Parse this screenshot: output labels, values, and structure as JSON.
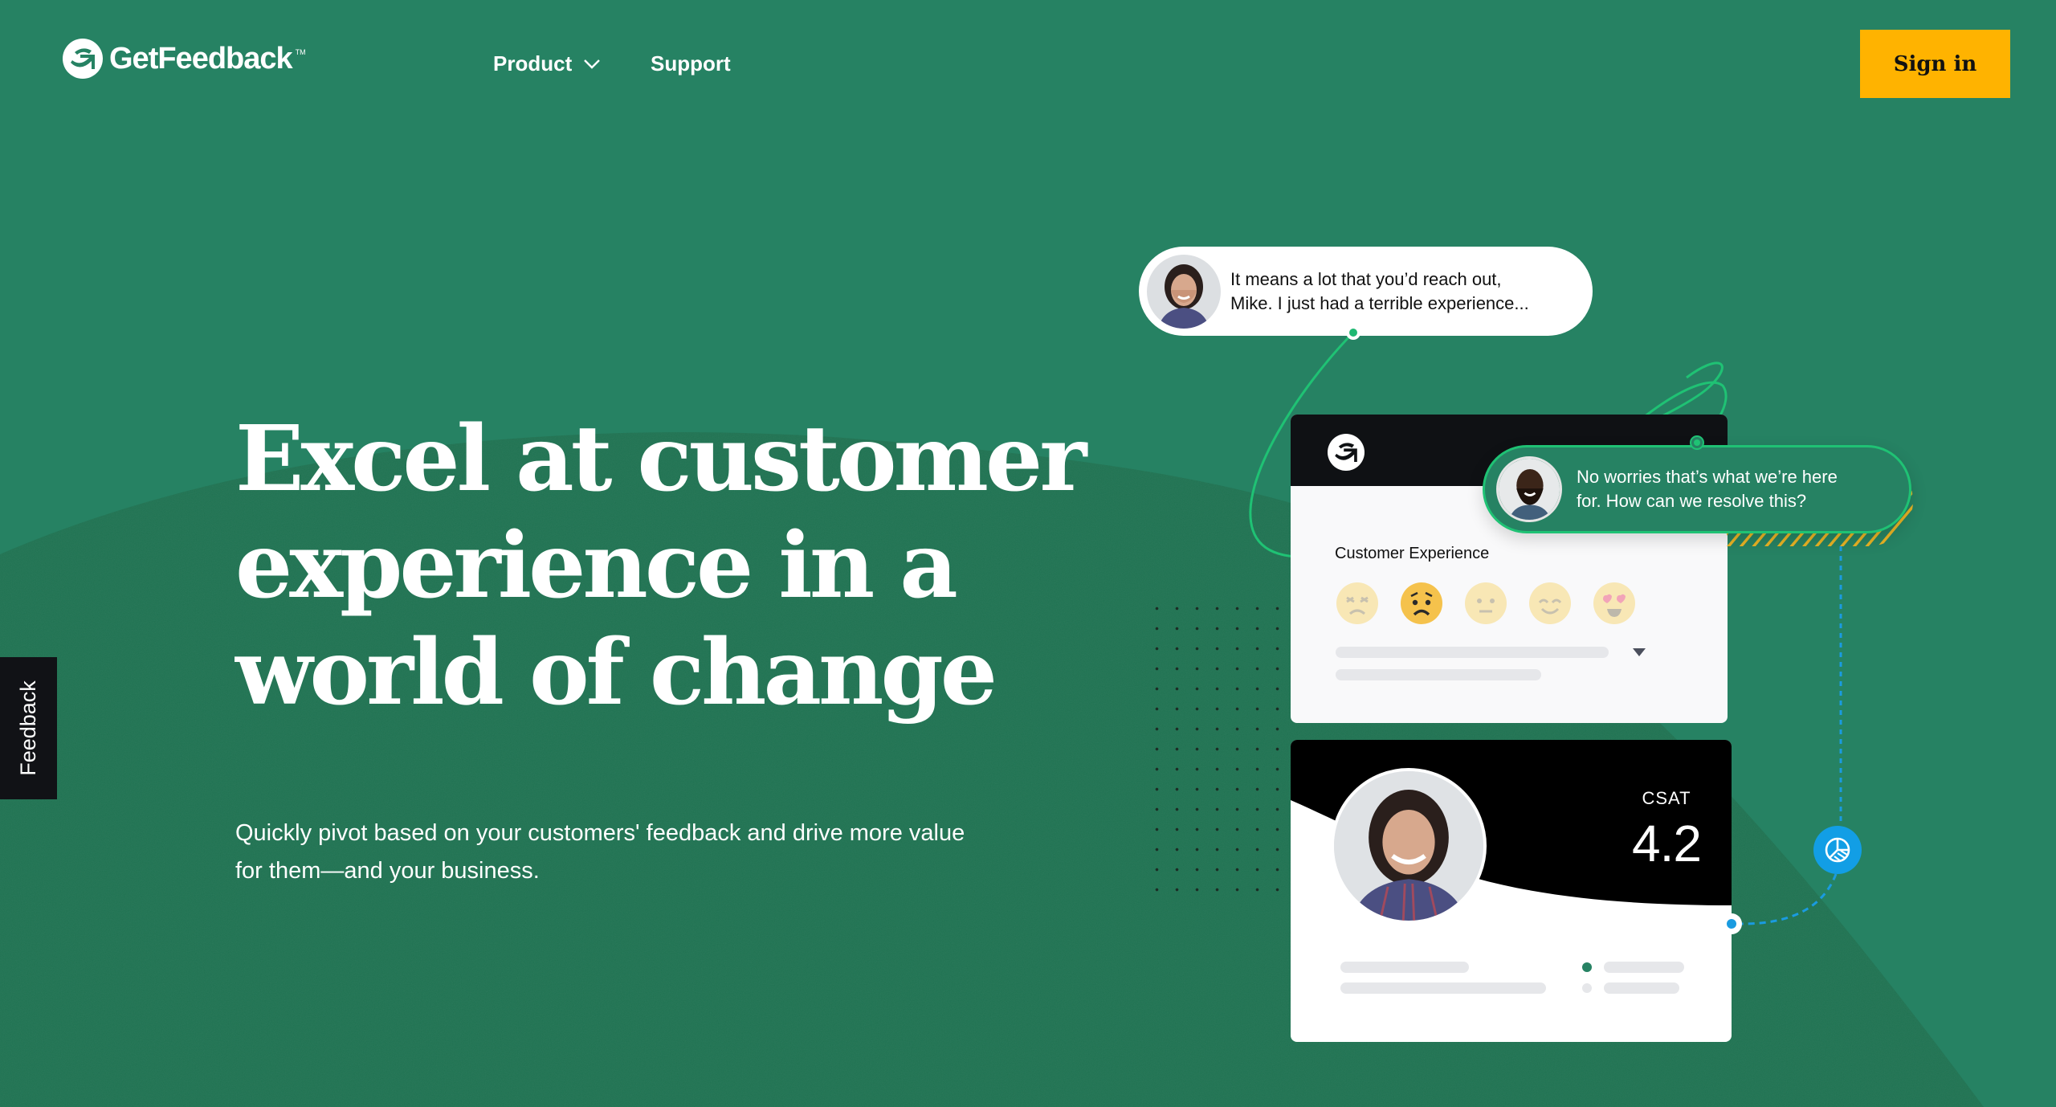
{
  "brand": {
    "name": "GetFeedback",
    "trademark": "TM",
    "logo_icon": "getfeedback-logo-icon"
  },
  "nav": {
    "items": [
      {
        "label": "Product",
        "has_dropdown": true,
        "icon": "chevron-down-icon"
      },
      {
        "label": "Support",
        "has_dropdown": false
      }
    ],
    "sign_in_label": "Sign in"
  },
  "hero": {
    "headline_lines": [
      "Excel at customer",
      "experience in a",
      "world of change"
    ],
    "subtext_lines": [
      "Quickly pivot based on your customers' feedback and drive more value",
      "for them—and your business."
    ]
  },
  "feedback_tab": {
    "label": "Feedback"
  },
  "illustration": {
    "customer_bubble": {
      "lines": [
        "It means a lot that you’d reach out,",
        "Mike. I just had a terrible experience..."
      ],
      "avatar": "customer-avatar"
    },
    "agent_bubble": {
      "lines": [
        "No worries that’s what we’re here",
        "for. How can we resolve this?"
      ],
      "avatar": "agent-avatar"
    },
    "survey_card": {
      "label": "Customer Experience",
      "ratings": [
        {
          "icon": "angry-face-icon",
          "selected": false
        },
        {
          "icon": "worried-face-icon",
          "selected": true
        },
        {
          "icon": "neutral-face-icon",
          "selected": false
        },
        {
          "icon": "smiling-face-icon",
          "selected": false
        },
        {
          "icon": "heart-eyes-face-icon",
          "selected": false
        }
      ],
      "selected_rating_index": 1
    },
    "csat_card": {
      "label": "CSAT",
      "value": "4.2"
    },
    "badge_icon": "pie-chart-icon"
  },
  "colors": {
    "background": "#268263",
    "accent_yellow": "#ffb300",
    "connector_green": "#1fc274",
    "connector_blue": "#1a9be0",
    "dark": "#0f1114"
  }
}
